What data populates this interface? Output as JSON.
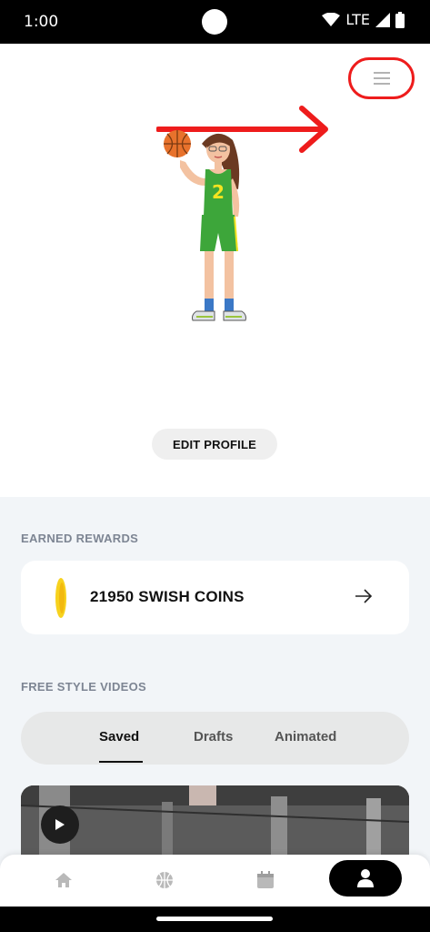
{
  "status_bar": {
    "time": "1:00",
    "network": "LTE"
  },
  "header": {
    "menu_icon": "hamburger-menu-icon"
  },
  "profile": {
    "edit_label": "EDIT PROFILE",
    "jersey_number": "2"
  },
  "rewards": {
    "section_label": "EARNED REWARDS",
    "coins_text": "21950 SWISH COINS"
  },
  "videos": {
    "section_label": "FREE STYLE VIDEOS",
    "tabs": [
      {
        "label": "Saved",
        "active": true
      },
      {
        "label": "Drafts",
        "active": false
      },
      {
        "label": "Animated",
        "active": false
      }
    ]
  },
  "bottom_nav": {
    "items": [
      "home-icon",
      "basketball-icon",
      "calendar-icon",
      "profile-icon"
    ],
    "active": "profile-icon"
  },
  "colors": {
    "annotation_red": "#ee1c1c",
    "background_light": "#f2f5f8",
    "coin_gold": "#f7d21e"
  }
}
